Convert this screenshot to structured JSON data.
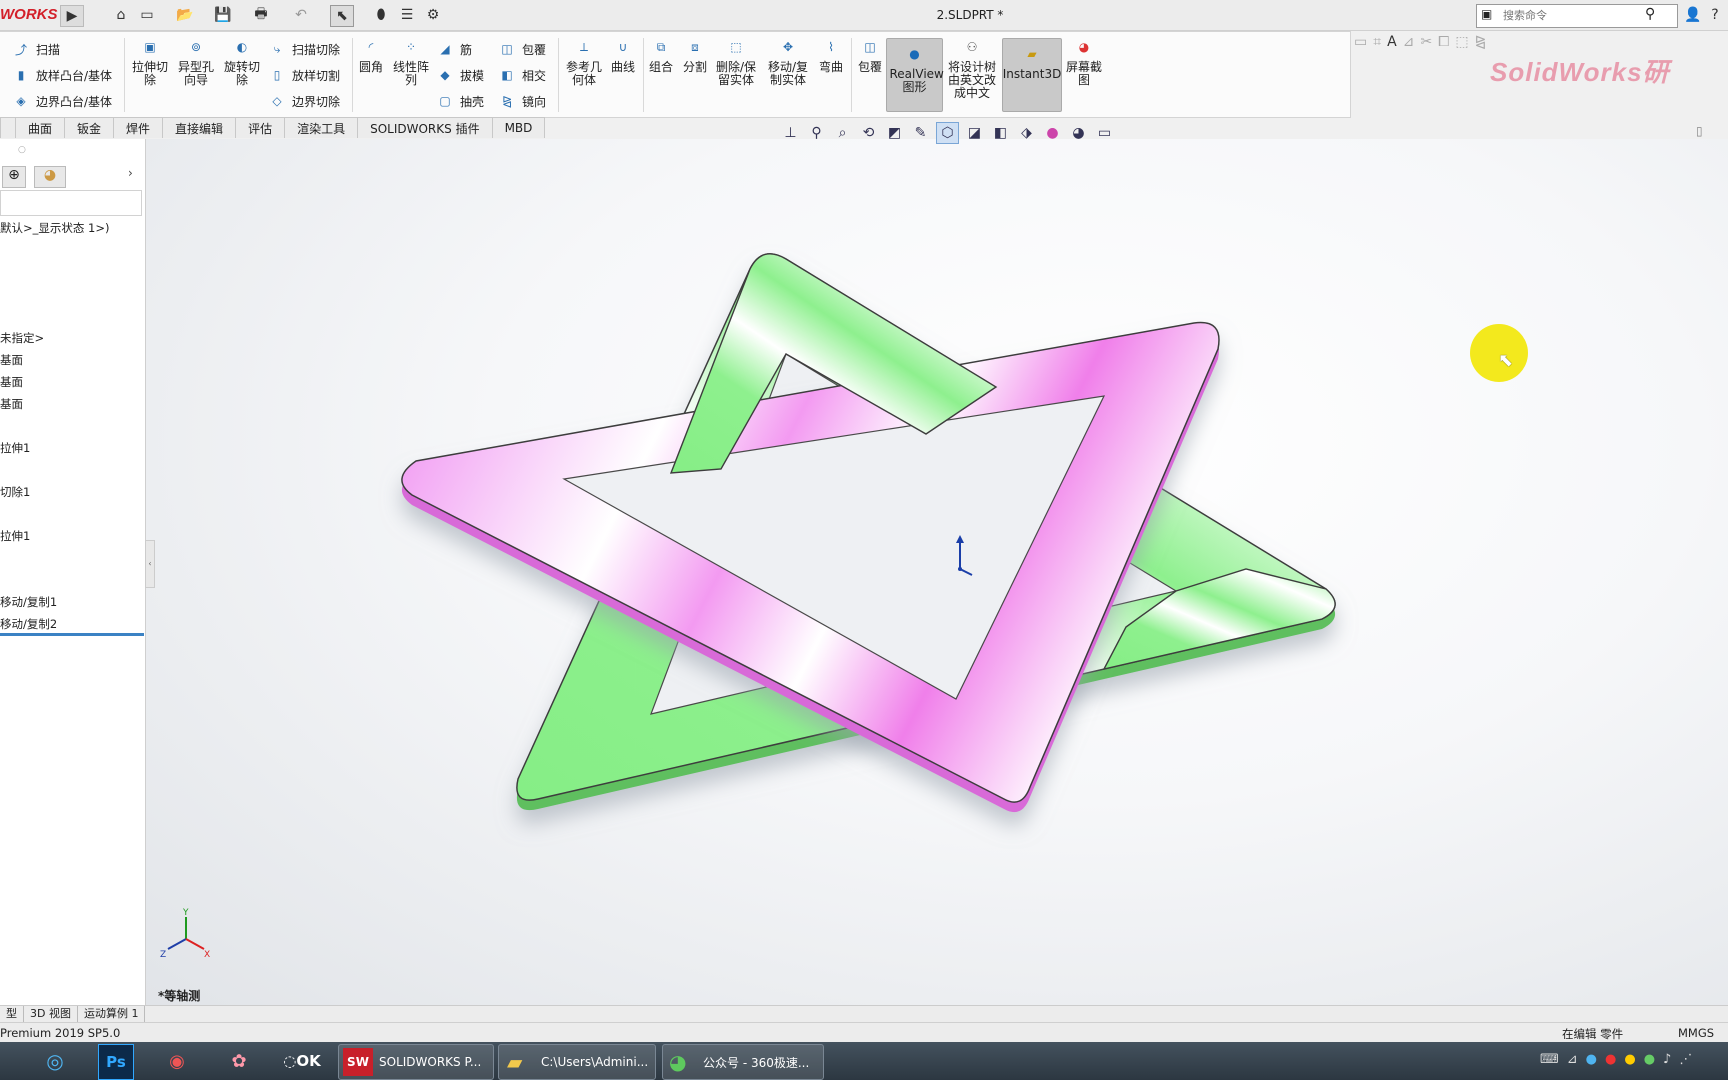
{
  "titlebar": {
    "brand": "WORKS",
    "document_title": "2.SLDPRT *",
    "search_placeholder": "搜索命令"
  },
  "ribbon": {
    "sweep": "扫描",
    "loft_boss": "放样凸台/基体",
    "boundary_boss": "边界凸台/基体",
    "extrude_cut": "拉伸切除",
    "hole_wizard": "异型孔向导",
    "revolve_cut": "旋转切除",
    "swept_cut": "扫描切除",
    "lofted_cut": "放样切割",
    "boundary_cut": "边界切除",
    "fillet": "圆角",
    "linear_pattern": "线性阵列",
    "rib": "筋",
    "draft": "拔模",
    "shell": "抽壳",
    "wrap": "包覆",
    "intersect": "相交",
    "mirror": "镜向",
    "ref_geometry": "参考几何体",
    "curves": "曲线",
    "combine": "组合",
    "split": "分割",
    "delete_keep_body": "删除/保留实体",
    "move_copy_body": "移动/复制实体",
    "flex": "弯曲",
    "wrap2": "包覆",
    "realview": "RealView图形",
    "translate_tree": "将设计树由英文改成中文",
    "instant3d": "Instant3D",
    "screen_capture": "屏幕截图",
    "watermark": "SolidWorks研"
  },
  "tabs": [
    "曲面",
    "钣金",
    "焊件",
    "直接编辑",
    "评估",
    "渲染工具",
    "SOLIDWORKS 插件",
    "MBD"
  ],
  "tree": {
    "display_state": "默认>_显示状态 1>)",
    "unassigned": "未指定>",
    "plane1": "基面",
    "plane2": "基面",
    "plane3": "基面",
    "item1": "拉伸1",
    "item2": "切除1",
    "item3": "拉伸1",
    "move_copy1": "移动/复制1",
    "move_copy2": "移动/复制2"
  },
  "viewport": {
    "view_label": "*等轴测"
  },
  "bottom_tabs": [
    "型",
    "3D 视图",
    "运动算例 1"
  ],
  "status": {
    "version": "Premium 2019 SP5.0",
    "editing": "在编辑 零件",
    "units": "MMGS"
  },
  "taskbar": {
    "solidworks": "SOLIDWORKS P...",
    "explorer": "C:\\Users\\Admini...",
    "browser": "公众号 - 360极速..."
  }
}
